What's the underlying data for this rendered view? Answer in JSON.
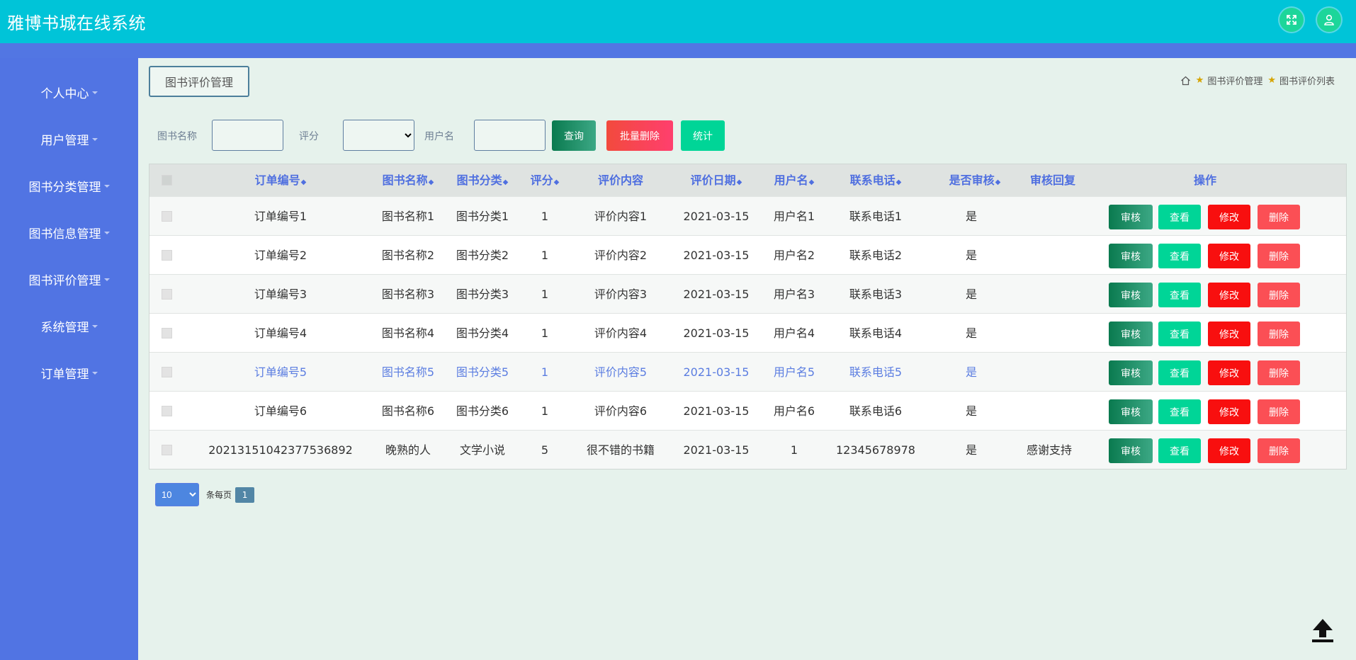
{
  "app": {
    "title": "雅博书城在线系统"
  },
  "header": {
    "fullscreen_icon": "fullscreen-icon",
    "user_icon": "user-icon"
  },
  "sidebar": {
    "items": [
      {
        "label": "个人中心"
      },
      {
        "label": "用户管理"
      },
      {
        "label": "图书分类管理"
      },
      {
        "label": "图书信息管理"
      },
      {
        "label": "图书评价管理"
      },
      {
        "label": "系统管理"
      },
      {
        "label": "订单管理"
      }
    ]
  },
  "page": {
    "tab_title": "图书评价管理",
    "breadcrumb": {
      "home_icon": "home-icon",
      "crumb1": "图书评价管理",
      "crumb2": "图书评价列表"
    }
  },
  "search": {
    "book_name_label": "图书名称",
    "book_name_value": "",
    "rating_label": "评分",
    "rating_value": "",
    "username_label": "用户名",
    "username_value": "",
    "query_button": "查询",
    "batch_delete_button": "批量删除",
    "stats_button": "统计"
  },
  "table": {
    "headers": {
      "order_no": "订单编号",
      "book_name": "图书名称",
      "category": "图书分类",
      "rating": "评分",
      "content": "评价内容",
      "date": "评价日期",
      "username": "用户名",
      "phone": "联系电话",
      "audited": "是否审核",
      "reply": "审核回复",
      "actions": "操作"
    },
    "action_labels": {
      "audit": "审核",
      "view": "查看",
      "edit": "修改",
      "delete": "删除"
    },
    "rows": [
      {
        "order_no": "订单编号1",
        "book_name": "图书名称1",
        "category": "图书分类1",
        "rating": "1",
        "content": "评价内容1",
        "date": "2021-03-15",
        "username": "用户名1",
        "phone": "联系电话1",
        "audited": "是",
        "reply": ""
      },
      {
        "order_no": "订单编号2",
        "book_name": "图书名称2",
        "category": "图书分类2",
        "rating": "1",
        "content": "评价内容2",
        "date": "2021-03-15",
        "username": "用户名2",
        "phone": "联系电话2",
        "audited": "是",
        "reply": ""
      },
      {
        "order_no": "订单编号3",
        "book_name": "图书名称3",
        "category": "图书分类3",
        "rating": "1",
        "content": "评价内容3",
        "date": "2021-03-15",
        "username": "用户名3",
        "phone": "联系电话3",
        "audited": "是",
        "reply": ""
      },
      {
        "order_no": "订单编号4",
        "book_name": "图书名称4",
        "category": "图书分类4",
        "rating": "1",
        "content": "评价内容4",
        "date": "2021-03-15",
        "username": "用户名4",
        "phone": "联系电话4",
        "audited": "是",
        "reply": ""
      },
      {
        "order_no": "订单编号5",
        "book_name": "图书名称5",
        "category": "图书分类5",
        "rating": "1",
        "content": "评价内容5",
        "date": "2021-03-15",
        "username": "用户名5",
        "phone": "联系电话5",
        "audited": "是",
        "reply": ""
      },
      {
        "order_no": "订单编号6",
        "book_name": "图书名称6",
        "category": "图书分类6",
        "rating": "1",
        "content": "评价内容6",
        "date": "2021-03-15",
        "username": "用户名6",
        "phone": "联系电话6",
        "audited": "是",
        "reply": ""
      },
      {
        "order_no": "20213151042377536892",
        "book_name": "晚熟的人",
        "category": "文学小说",
        "rating": "5",
        "content": "很不错的书籍",
        "date": "2021-03-15",
        "username": "1",
        "phone": "12345678978",
        "audited": "是",
        "reply": "感谢支持"
      }
    ]
  },
  "pagination": {
    "page_size": "10",
    "per_page_label": "条每页",
    "current_page": "1"
  },
  "colors": {
    "header": "#00c4d8",
    "sidebar": "#5174e3",
    "accent": "#4f6fe0",
    "background": "#e6f2ec"
  }
}
